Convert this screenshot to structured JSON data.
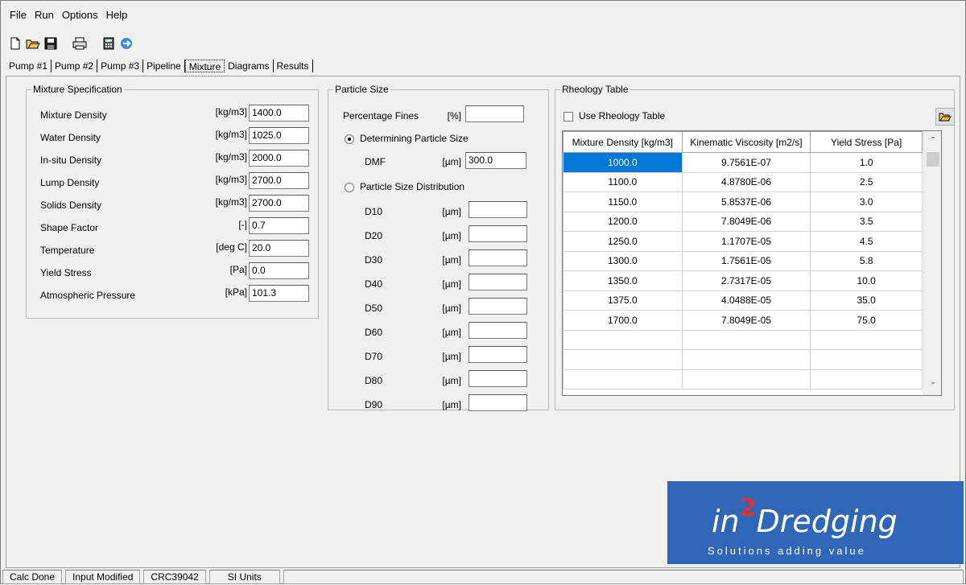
{
  "menu": [
    "File",
    "Run",
    "Options",
    "Help"
  ],
  "toolbar": [
    "new-file-icon",
    "open-folder-icon",
    "save-icon",
    "print-icon",
    "calculator-icon",
    "transfer-icon"
  ],
  "tabs": [
    "Pump #1",
    "Pump #2",
    "Pump #3",
    "Pipeline",
    "Mixture",
    "Diagrams",
    "Results"
  ],
  "active_tab": "Mixture",
  "mixture_spec": {
    "title": "Mixture Specification",
    "fields": [
      {
        "label": "Mixture Density",
        "unit": "[kg/m3]",
        "value": "1400.0"
      },
      {
        "label": "Water Density",
        "unit": "[kg/m3]",
        "value": "1025.0"
      },
      {
        "label": "In-situ Density",
        "unit": "[kg/m3]",
        "value": "2000.0"
      },
      {
        "label": "Lump Density",
        "unit": "[kg/m3]",
        "value": "2700.0"
      },
      {
        "label": "Solids Density",
        "unit": "[kg/m3]",
        "value": "2700.0"
      },
      {
        "label": "Shape Factor",
        "unit": "[-]",
        "value": "0.7"
      },
      {
        "label": "Temperature",
        "unit": "[deg C]",
        "value": "20.0"
      },
      {
        "label": "Yield Stress",
        "unit": "[Pa]",
        "value": "0.0"
      },
      {
        "label": "Atmospheric Pressure",
        "unit": "[kPa]",
        "value": "101.3"
      }
    ]
  },
  "particle_size": {
    "title": "Particle Size",
    "fines_label": "Percentage Fines",
    "fines_unit": "[%]",
    "fines_value": "",
    "determining_label": "Determining Particle Size",
    "determining_checked": true,
    "dmf_label": "DMF",
    "dmf_unit": "[µm]",
    "dmf_value": "300.0",
    "distribution_label": "Particle Size Distribution",
    "distribution_checked": false,
    "distribution": [
      {
        "label": "D10",
        "unit": "[µm]",
        "value": ""
      },
      {
        "label": "D20",
        "unit": "[µm]",
        "value": ""
      },
      {
        "label": "D30",
        "unit": "[µm]",
        "value": ""
      },
      {
        "label": "D40",
        "unit": "[µm]",
        "value": ""
      },
      {
        "label": "D50",
        "unit": "[µm]",
        "value": ""
      },
      {
        "label": "D60",
        "unit": "[µm]",
        "value": ""
      },
      {
        "label": "D70",
        "unit": "[µm]",
        "value": ""
      },
      {
        "label": "D80",
        "unit": "[µm]",
        "value": ""
      },
      {
        "label": "D90",
        "unit": "[µm]",
        "value": ""
      }
    ]
  },
  "rheology": {
    "title": "Rheology Table",
    "use_label": "Use Rheology Table",
    "use_checked": false,
    "columns": [
      "Mixture Density [kg/m3]",
      "Kinematic Viscosity [m2/s]",
      "Yield Stress [Pa]"
    ],
    "rows": [
      [
        "1000.0",
        "9.7561E-07",
        "1.0"
      ],
      [
        "1100.0",
        "4.8780E-06",
        "2.5"
      ],
      [
        "1150.0",
        "5.8537E-06",
        "3.0"
      ],
      [
        "1200.0",
        "7.8049E-06",
        "3.5"
      ],
      [
        "1250.0",
        "1.1707E-05",
        "4.5"
      ],
      [
        "1300.0",
        "1.7561E-05",
        "5.8"
      ],
      [
        "1350.0",
        "2.7317E-05",
        "10.0"
      ],
      [
        "1375.0",
        "4.0488E-05",
        "35.0"
      ],
      [
        "1700.0",
        "7.8049E-05",
        "75.0"
      ],
      [
        "",
        "",
        ""
      ],
      [
        "",
        "",
        ""
      ],
      [
        "",
        "",
        ""
      ]
    ]
  },
  "logo": {
    "prefix": "in",
    "superscript": "2",
    "main": "Dredging",
    "tagline": "Solutions adding value"
  },
  "status": [
    "Calc Done",
    "Input Modified",
    "CRC39042",
    "SI Units"
  ],
  "colors": {
    "selection": "#0078d7",
    "logo_bg": "#2e66b8"
  }
}
